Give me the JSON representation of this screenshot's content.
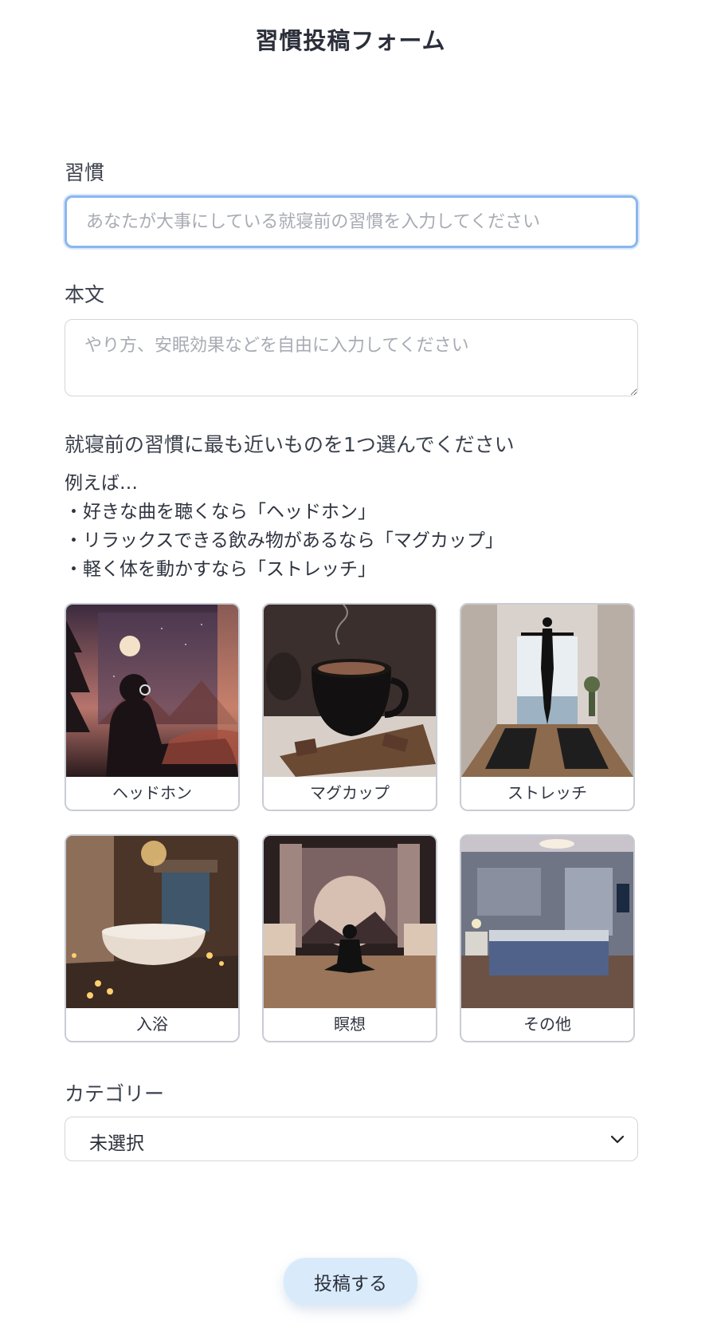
{
  "page": {
    "title": "習慣投稿フォーム"
  },
  "habit": {
    "label": "習慣",
    "placeholder": "あなたが大事にしている就寝前の習慣を入力してください",
    "value": ""
  },
  "body": {
    "label": "本文",
    "placeholder": "やり方、安眠効果などを自由に入力してください",
    "value": ""
  },
  "choose": {
    "heading": "就寝前の習慣に最も近いものを1つ選んでください",
    "examples": [
      "例えば…",
      "・好きな曲を聴くなら「ヘッドホン」",
      "・リラックスできる飲み物があるなら「マグカップ」",
      "・軽く体を動かすなら「ストレッチ」"
    ]
  },
  "options": [
    {
      "label": "ヘッドホン",
      "icon": "headphones-image"
    },
    {
      "label": "マグカップ",
      "icon": "mug-image"
    },
    {
      "label": "ストレッチ",
      "icon": "stretch-image"
    },
    {
      "label": "入浴",
      "icon": "bath-image"
    },
    {
      "label": "瞑想",
      "icon": "meditation-image"
    },
    {
      "label": "その他",
      "icon": "other-bedroom-image"
    }
  ],
  "category": {
    "label": "カテゴリー",
    "selected": "未選択"
  },
  "submit": {
    "label": "投稿する"
  },
  "colors": {
    "focus_border": "#8ab7ee",
    "submit_bg": "#d9ebfb",
    "text": "#2f3440"
  }
}
